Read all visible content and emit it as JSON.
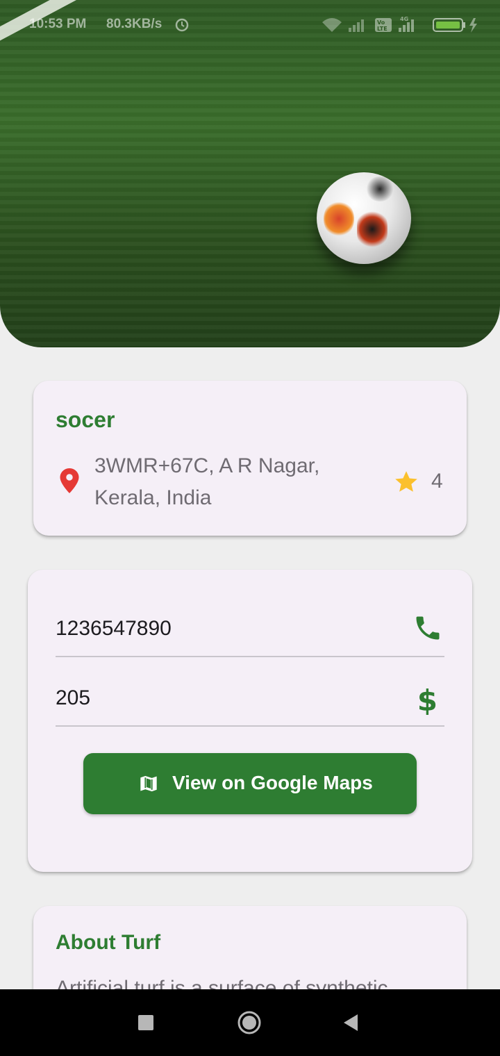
{
  "status_bar": {
    "time": "10:53 PM",
    "network_speed": "80.3KB/s",
    "icons": [
      "alarm-icon",
      "wifi-icon",
      "signal-icon",
      "volte-icon",
      "4g-signal-icon",
      "battery-icon",
      "charging-icon"
    ]
  },
  "hero": {
    "image": "soccer-ball-on-turf"
  },
  "turf": {
    "name": "socer",
    "address": "3WMR+67C, A R Nagar, Kerala, India",
    "rating": "4",
    "location_icon": "location-pin-icon",
    "rating_icon": "star-icon"
  },
  "contact": {
    "phone": "1236547890",
    "phone_icon": "phone-icon",
    "price": "205",
    "price_icon": "$",
    "maps_button_label": "View on Google Maps",
    "maps_icon": "map-icon"
  },
  "about": {
    "title": "About Turf",
    "text": "Artificial turf is a surface of synthetic"
  },
  "colors": {
    "accent": "#2e7d32",
    "card_background": "#f5eff7",
    "page_background": "#eeeeee",
    "location_pin": "#e53935",
    "star": "#fbc02d",
    "secondary_text": "#6f6b72"
  },
  "nav_bar": {
    "buttons": [
      "recent-apps",
      "home",
      "back"
    ]
  }
}
